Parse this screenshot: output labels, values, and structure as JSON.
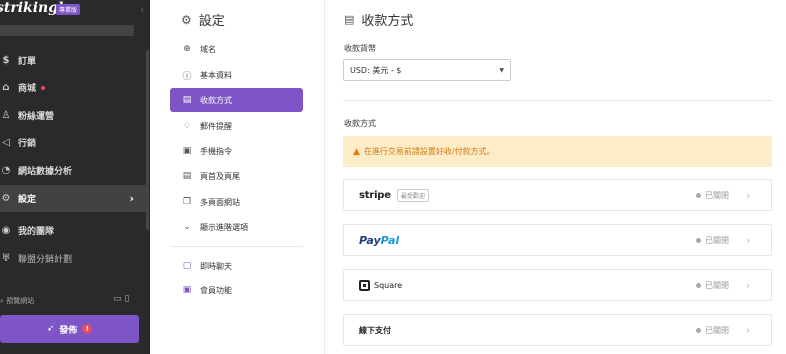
{
  "sidebar": {
    "logo": "strikingly",
    "pro_badge": "專業版",
    "collapse_icon": "chevron-left",
    "items": [
      {
        "label": "訂單",
        "icon": "dollar-circle"
      },
      {
        "label": "商城",
        "icon": "store"
      },
      {
        "label": "粉絲運營",
        "icon": "users"
      },
      {
        "label": "行銷",
        "icon": "megaphone"
      },
      {
        "label": "網站數據分析",
        "icon": "chart-pie"
      },
      {
        "label": "設定",
        "icon": "gear"
      },
      {
        "label": "我的團隊",
        "icon": "team"
      },
      {
        "label": "聯盟分銷計劃",
        "icon": "trophy"
      }
    ],
    "search_label": "預覽網站",
    "publish_label": "發佈",
    "publish_warning": "!"
  },
  "settings": {
    "title": "設定",
    "items": [
      {
        "label": "域名",
        "icon": "globe"
      },
      {
        "label": "基本資料",
        "icon": "info"
      },
      {
        "label": "收款方式",
        "icon": "credit-card"
      },
      {
        "label": "郵件提醒",
        "icon": "bell"
      },
      {
        "label": "手機指令",
        "icon": "phone"
      },
      {
        "label": "頁首及頁尾",
        "icon": "layout"
      },
      {
        "label": "多頁面網站",
        "icon": "pages"
      },
      {
        "label": "顯示進階選項",
        "icon": "chevron-down"
      },
      {
        "label": "即時聊天",
        "icon": "chat"
      },
      {
        "label": "會員功能",
        "icon": "member"
      }
    ]
  },
  "main": {
    "title": "收款方式",
    "currency_label": "收款貨幣",
    "currency_value": "USD: 美元 - $",
    "section_label": "收款方式",
    "alert_text": "在進行交易前請設置好收/付款方式。",
    "providers": [
      {
        "name": "stripe",
        "tag": "最受歡迎",
        "status": "已關閉"
      },
      {
        "name_pay": "Pay",
        "name_pal": "Pal",
        "status": "已關閉"
      },
      {
        "name": "Square",
        "status": "已關閉"
      },
      {
        "name": "線下支付",
        "status": "已關閉"
      }
    ]
  },
  "colors": {
    "accent": "#7d55c7",
    "sidebar_bg": "#2a2a2c",
    "alert_bg": "#fdecc8",
    "alert_text": "#d07a10"
  }
}
